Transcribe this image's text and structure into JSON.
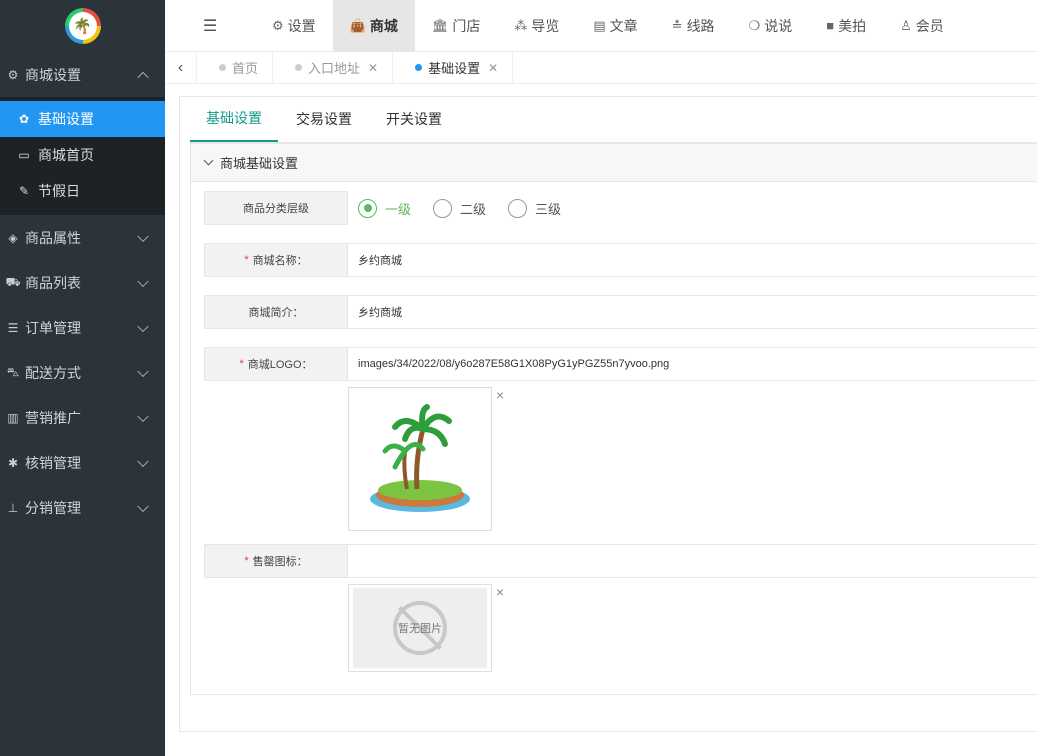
{
  "sidebar": {
    "logo_icon": "palm-logo",
    "groups": [
      {
        "label": "商城设置",
        "icon": "gears-icon",
        "open": true
      },
      {
        "label": "商品属性",
        "icon": "cube-icon"
      },
      {
        "label": "商品列表",
        "icon": "cart-icon"
      },
      {
        "label": "订单管理",
        "icon": "list-icon"
      },
      {
        "label": "配送方式",
        "icon": "car-icon"
      },
      {
        "label": "营销推广",
        "icon": "bar-chart-icon"
      },
      {
        "label": "核销管理",
        "icon": "asterisk-icon"
      },
      {
        "label": "分销管理",
        "icon": "sitemap-icon"
      }
    ],
    "subitems": [
      {
        "label": "基础设置",
        "icon": "gear-icon",
        "active": true
      },
      {
        "label": "商城首页",
        "icon": "monitor-icon"
      },
      {
        "label": "节假日",
        "icon": "edit-icon"
      }
    ],
    "active_color": "#2196f3"
  },
  "topnav": {
    "items": [
      {
        "label": "设置",
        "icon": "gears-icon"
      },
      {
        "label": "商城",
        "icon": "shop-bag-icon",
        "active": true
      },
      {
        "label": "门店",
        "icon": "bank-icon"
      },
      {
        "label": "导览",
        "icon": "cubes-icon"
      },
      {
        "label": "文章",
        "icon": "newspaper-icon"
      },
      {
        "label": "线路",
        "icon": "route-icon"
      },
      {
        "label": "说说",
        "icon": "wechat-icon"
      },
      {
        "label": "美拍",
        "icon": "video-icon"
      },
      {
        "label": "会员",
        "icon": "user-icon"
      }
    ]
  },
  "tabs": [
    {
      "label": "首页",
      "closable": false
    },
    {
      "label": "入口地址",
      "closable": true
    },
    {
      "label": "基础设置",
      "closable": true,
      "active": true
    }
  ],
  "subtabs": [
    "基础设置",
    "交易设置",
    "开关设置"
  ],
  "panel": {
    "title": "商城基础设置",
    "category_level": {
      "label": "商品分类层级",
      "options": [
        "一级",
        "二级",
        "三级"
      ],
      "selected": "一级"
    },
    "shop_name": {
      "label": "商城名称：",
      "value": "乡约商城"
    },
    "shop_intro": {
      "label": "商城简介：",
      "value": "乡约商城"
    },
    "shop_logo": {
      "label": "商城LOGO：",
      "value": "images/34/2022/08/y6o287E58G1X08PyG1yPGZ55n7yvoo.png"
    },
    "sale_icon": {
      "label": "售罄图标：",
      "value": "",
      "placeholder_text": "暂无图片"
    },
    "close_symbol": "×"
  },
  "colors": {
    "sidebar_bg": "#2b333b",
    "accent_green": "#159a8a",
    "radio_green": "#5cb85c",
    "required_red": "#e53935"
  }
}
